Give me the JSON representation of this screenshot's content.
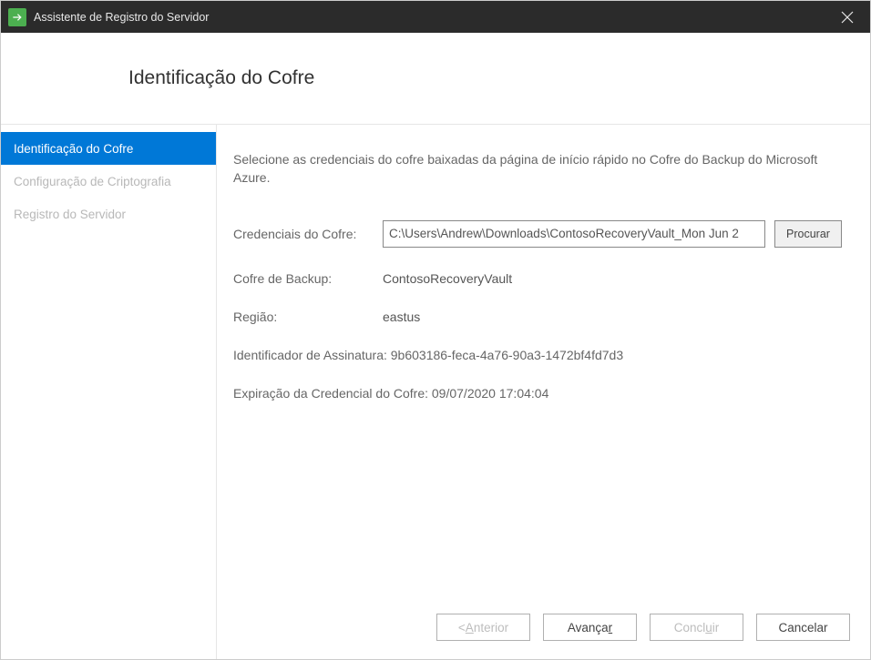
{
  "titlebar": {
    "title": "Assistente de Registro do Servidor"
  },
  "header": {
    "title": "Identificação do Cofre"
  },
  "sidebar": {
    "items": [
      {
        "label": "Identificação do Cofre",
        "active": true
      },
      {
        "label": "Configuração de Criptografia",
        "active": false
      },
      {
        "label": "Registro do Servidor",
        "active": false
      }
    ]
  },
  "main": {
    "description": "Selecione as credenciais do cofre baixadas da página de início rápido no Cofre do Backup do Microsoft Azure.",
    "credentials": {
      "label": "Credenciais do Cofre:",
      "value": "C:\\Users\\Andrew\\Downloads\\ContosoRecoveryVault_Mon Jun 2",
      "browse_label": "Procurar"
    },
    "backup_vault": {
      "label": "Cofre de Backup:",
      "value": "ContosoRecoveryVault"
    },
    "region": {
      "label": "Região:",
      "value": "eastus"
    },
    "subscription": {
      "combined": "Identificador de Assinatura: 9b603186-feca-4a76-90a3-1472bf4fd7d3"
    },
    "expiration": {
      "combined": "Expiração da Credencial do Cofre: 09/07/2020 17:04:04"
    }
  },
  "footer": {
    "previous_prefix": "< ",
    "previous_label": "Anterior",
    "previous_key": "A",
    "next_label": "Avançar",
    "next_key": "r",
    "finish_label": "Concluir",
    "finish_key": "u",
    "cancel_label": "Cancelar"
  }
}
